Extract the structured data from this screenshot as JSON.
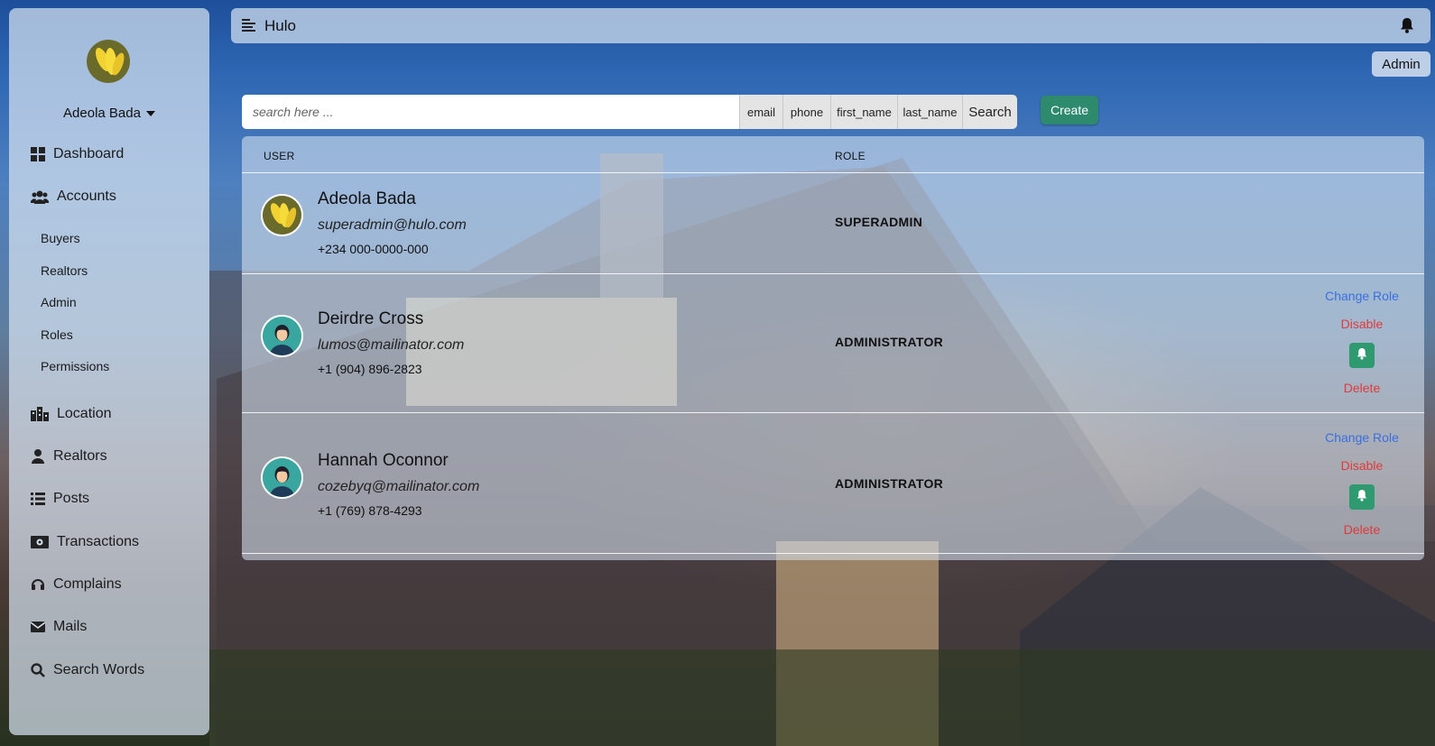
{
  "header": {
    "brand": "Hulo",
    "admin_label": "Admin"
  },
  "sidebar": {
    "user_name": "Adeola Bada",
    "items": [
      {
        "label": "Dashboard",
        "icon": "grid-icon"
      },
      {
        "label": "Accounts",
        "icon": "users-icon"
      },
      {
        "label": "Location",
        "icon": "buildings-icon"
      },
      {
        "label": "Realtors",
        "icon": "user-icon"
      },
      {
        "label": "Posts",
        "icon": "list-icon"
      },
      {
        "label": "Transactions",
        "icon": "money-icon"
      },
      {
        "label": "Complains",
        "icon": "headset-icon"
      },
      {
        "label": "Mails",
        "icon": "mail-icon"
      },
      {
        "label": "Search Words",
        "icon": "search-icon"
      }
    ],
    "accounts_sub": [
      "Buyers",
      "Realtors",
      "Admin",
      "Roles",
      "Permissions"
    ]
  },
  "search": {
    "placeholder": "search here ...",
    "filters": [
      "email",
      "phone",
      "first_name",
      "last_name"
    ],
    "search_label": "Search",
    "create_label": "Create"
  },
  "table": {
    "columns": [
      "USER",
      "ROLE"
    ],
    "rows": [
      {
        "name": "Adeola Bada",
        "email": "superadmin@hulo.com",
        "phone": "+234 000-0000-000",
        "role": "SUPERADMIN"
      },
      {
        "name": "Deirdre Cross",
        "email": "lumos@mailinator.com",
        "phone": "+1 (904) 896-2823",
        "role": "ADMINISTRATOR"
      },
      {
        "name": "Hannah Oconnor",
        "email": "cozebyq@mailinator.com",
        "phone": "+1 (769) 878-4293",
        "role": "ADMINISTRATOR"
      }
    ],
    "actions": {
      "change_role": "Change Role",
      "disable": "Disable",
      "delete": "Delete"
    }
  },
  "colors": {
    "accent_green": "#2e8a6c",
    "link_blue": "#3a6fe0",
    "danger_red": "#e03a3a"
  }
}
